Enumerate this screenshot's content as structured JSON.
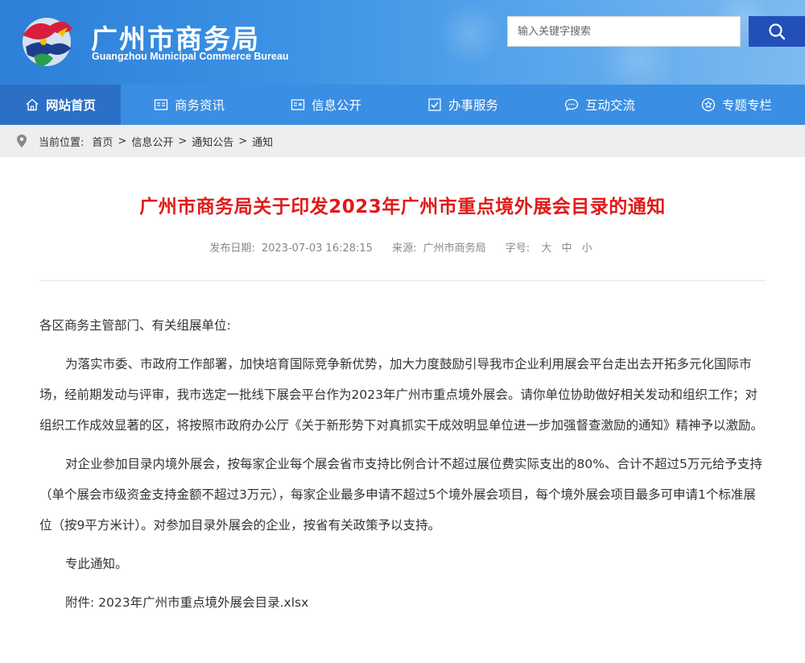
{
  "header": {
    "site_title": "广州市商务局",
    "site_subtitle": "Guangzhou Municipal Commerce Bureau",
    "search_placeholder": "输入关键字搜索"
  },
  "nav": {
    "items": [
      {
        "label": "网站首页",
        "icon": "home-icon",
        "active": true
      },
      {
        "label": "商务资讯",
        "icon": "news-icon"
      },
      {
        "label": "信息公开",
        "icon": "info-icon"
      },
      {
        "label": "办事服务",
        "icon": "service-icon"
      },
      {
        "label": "互动交流",
        "icon": "chat-icon"
      },
      {
        "label": "专题专栏",
        "icon": "star-icon"
      }
    ]
  },
  "breadcrumb": {
    "prefix": "当前位置:",
    "items": [
      "首页",
      "信息公开",
      "通知公告",
      "通知"
    ],
    "separator": ">"
  },
  "article": {
    "title": "广州市商务局关于印发2023年广州市重点境外展会目录的通知",
    "meta": {
      "date_label": "发布日期:",
      "date": "2023-07-03 16:28:15",
      "source_label": "来源:",
      "source": "广州市商务局",
      "fontsize_label": "字号:",
      "sizes": [
        "大",
        "中",
        "小"
      ]
    },
    "salutation": "各区商务主管部门、有关组展单位:",
    "paragraphs": [
      "为落实市委、市政府工作部署，加快培育国际竞争新优势，加大力度鼓励引导我市企业利用展会平台走出去开拓多元化国际市场，经前期发动与评审，我市选定一批线下展会平台作为2023年广州市重点境外展会。请你单位协助做好相关发动和组织工作；对组织工作成效显著的区，将按照市政府办公厅《关于新形势下对真抓实干成效明显单位进一步加强督查激励的通知》精神予以激励。",
      "对企业参加目录内境外展会，按每家企业每个展会省市支持比例合计不超过展位费实际支出的80%、合计不超过5万元给予支持（单个展会市级资金支持金额不超过3万元），每家企业最多申请不超过5个境外展会项目，每个境外展会项目最多可申请1个标准展位（按9平方米计）。对参加目录外展会的企业，按省有关政策予以支持。"
    ],
    "closing": "专此通知。",
    "attachment_label": "附件:",
    "attachment_file": "2023年广州市重点境外展会目录.xlsx"
  },
  "colors": {
    "header_blue": "#3c92e4",
    "nav_blue": "#3a8ee3",
    "nav_active": "#2c6fc6",
    "search_button": "#2350b8",
    "title_red": "#e01a1a"
  }
}
